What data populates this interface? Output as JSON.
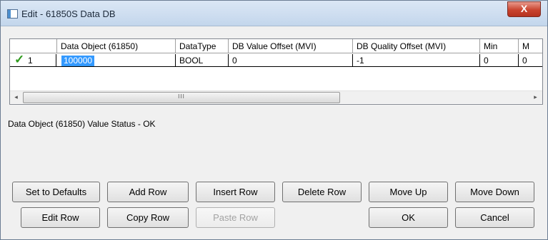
{
  "window": {
    "title": "Edit - 61850S Data DB",
    "close_label": "X"
  },
  "grid": {
    "columns": [
      "Data Object (61850)",
      "DataType",
      "DB Value Offset (MVI)",
      "DB Quality Offset (MVI)",
      "Min",
      "M"
    ],
    "rows": [
      {
        "row_number": "1",
        "status": "checkmark",
        "cells": [
          "100000",
          "BOOL",
          "0",
          "-1",
          "0",
          "0"
        ]
      }
    ],
    "scrollbar": {
      "left_arrow": "◂",
      "right_arrow": "▸",
      "thumb_grip": "III"
    }
  },
  "status_text": "Data Object (61850) Value Status - OK",
  "buttons": {
    "set_to_defaults": "Set to Defaults",
    "add_row": "Add Row",
    "insert_row": "Insert Row",
    "delete_row": "Delete Row",
    "move_up": "Move Up",
    "move_down": "Move Down",
    "edit_row": "Edit Row",
    "copy_row": "Copy Row",
    "paste_row": "Paste Row",
    "ok": "OK",
    "cancel": "Cancel"
  }
}
